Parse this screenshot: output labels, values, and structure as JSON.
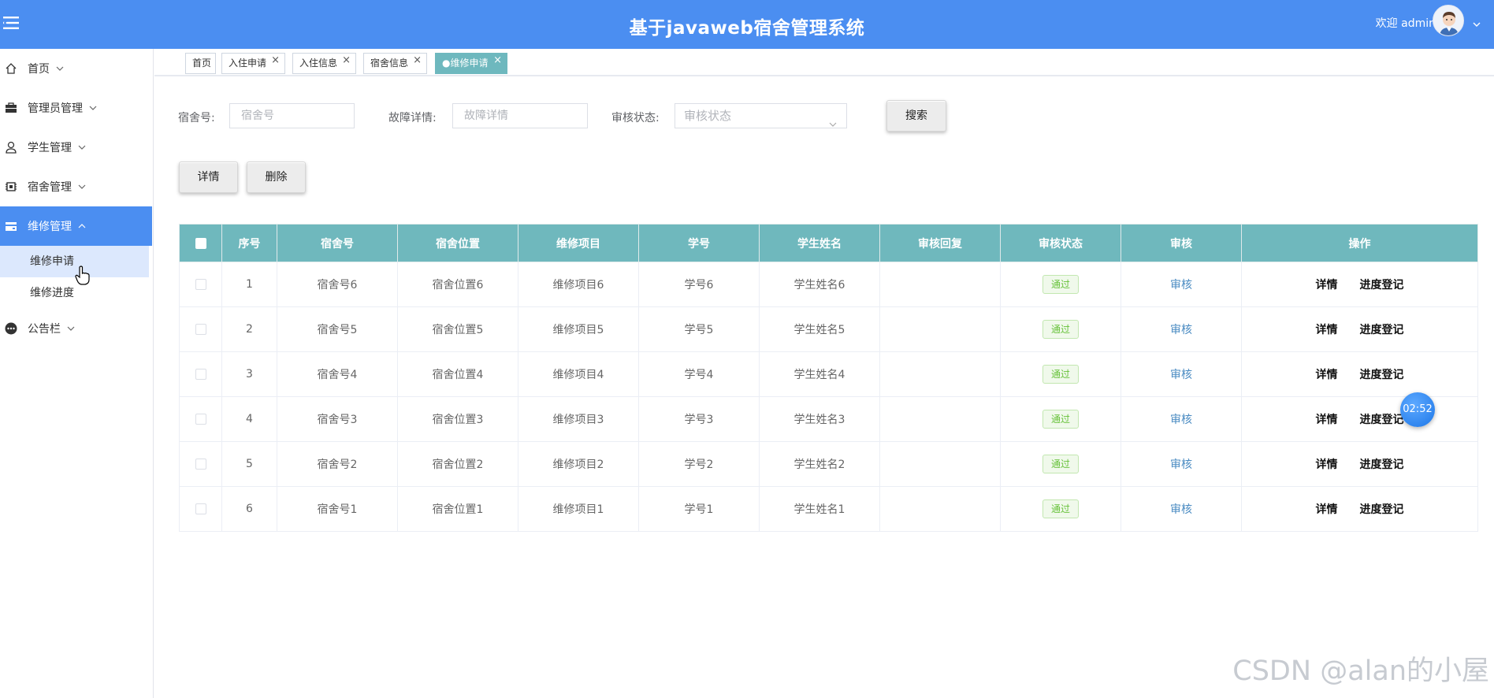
{
  "header": {
    "title": "基于javaweb宿舍管理系统",
    "welcome": "欢迎 admin"
  },
  "sidebar": {
    "items": [
      {
        "label": "首页",
        "icon": "home-icon"
      },
      {
        "label": "管理员管理",
        "icon": "briefcase-icon"
      },
      {
        "label": "学生管理",
        "icon": "user-icon"
      },
      {
        "label": "宿舍管理",
        "icon": "chip-icon"
      },
      {
        "label": "维修管理",
        "icon": "card-icon"
      },
      {
        "label": "公告栏",
        "icon": "more-circle-icon"
      }
    ],
    "sub_items": [
      {
        "label": "维修申请"
      },
      {
        "label": "维修进度"
      }
    ]
  },
  "tabs": [
    {
      "label": "首页"
    },
    {
      "label": "入住申请"
    },
    {
      "label": "入住信息"
    },
    {
      "label": "宿舍信息"
    },
    {
      "label": "●维修申请"
    }
  ],
  "filters": {
    "dorm_label": "宿舍号:",
    "dorm_placeholder": "宿舍号",
    "fault_label": "故障详情:",
    "fault_placeholder": "故障详情",
    "status_label": "审核状态:",
    "status_placeholder": "审核状态",
    "search_button": "搜索"
  },
  "actions": {
    "detail_button": "详情",
    "delete_button": "删除"
  },
  "table": {
    "headers": [
      "序号",
      "宿舍号",
      "宿舍位置",
      "维修项目",
      "学号",
      "学生姓名",
      "审核回复",
      "审核状态",
      "审核",
      "操作"
    ],
    "rows": [
      {
        "no": "1",
        "dorm": "宿舍号6",
        "location": "宿舍位置6",
        "item": "维修项目6",
        "student_id": "学号6",
        "name": "学生姓名6",
        "reply": "",
        "status": "通过",
        "audit": "审核",
        "op1": "详情",
        "op2": "进度登记"
      },
      {
        "no": "2",
        "dorm": "宿舍号5",
        "location": "宿舍位置5",
        "item": "维修项目5",
        "student_id": "学号5",
        "name": "学生姓名5",
        "reply": "",
        "status": "通过",
        "audit": "审核",
        "op1": "详情",
        "op2": "进度登记"
      },
      {
        "no": "3",
        "dorm": "宿舍号4",
        "location": "宿舍位置4",
        "item": "维修项目4",
        "student_id": "学号4",
        "name": "学生姓名4",
        "reply": "",
        "status": "通过",
        "audit": "审核",
        "op1": "详情",
        "op2": "进度登记"
      },
      {
        "no": "4",
        "dorm": "宿舍号3",
        "location": "宿舍位置3",
        "item": "维修项目3",
        "student_id": "学号3",
        "name": "学生姓名3",
        "reply": "",
        "status": "通过",
        "audit": "审核",
        "op1": "详情",
        "op2": "进度登记"
      },
      {
        "no": "5",
        "dorm": "宿舍号2",
        "location": "宿舍位置2",
        "item": "维修项目2",
        "student_id": "学号2",
        "name": "学生姓名2",
        "reply": "",
        "status": "通过",
        "audit": "审核",
        "op1": "详情",
        "op2": "进度登记"
      },
      {
        "no": "6",
        "dorm": "宿舍号1",
        "location": "宿舍位置1",
        "item": "维修项目1",
        "student_id": "学号1",
        "name": "学生姓名1",
        "reply": "",
        "status": "通过",
        "audit": "审核",
        "op1": "详情",
        "op2": "进度登记"
      }
    ]
  },
  "timer": "02:52",
  "watermark": "CSDN @alan的小屋",
  "colors": {
    "header": "#4b8ef1",
    "table_header": "#6fb8bd",
    "active_tab": "#6eb8be",
    "status_pass": "#67c23a"
  }
}
